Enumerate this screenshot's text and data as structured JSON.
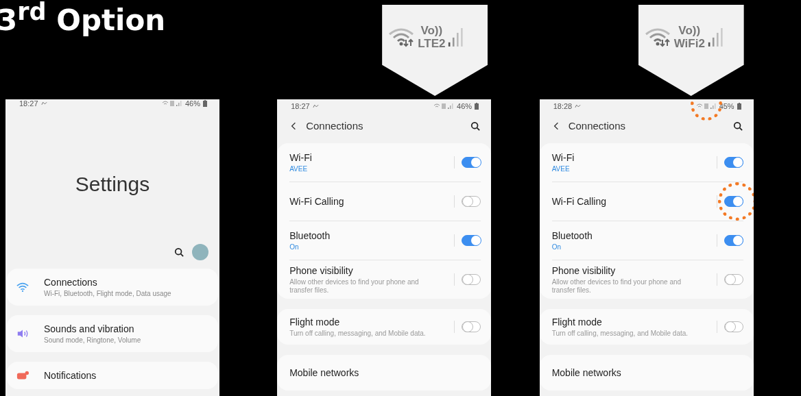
{
  "slide_title": "3$^{rd}$ Option",
  "phones": [
    {
      "kind": "home",
      "status": {
        "time": "18:27",
        "battery": "46%",
        "highlighted": false
      },
      "title": "Settings",
      "items": [
        {
          "kind": "wifi",
          "label": "Connections",
          "detail": "Wi-Fi, Bluetooth, Flight mode, Data usage"
        },
        {
          "kind": "sound",
          "label": "Sounds and vibration",
          "detail": "Sound mode, Ringtone, Volume"
        },
        {
          "kind": "notification",
          "label": "Notifications"
        }
      ]
    },
    {
      "kind": "connections",
      "callout": {
        "voice": "Vo))",
        "network": "LTE2"
      },
      "status": {
        "time": "18:27",
        "battery": "46%",
        "highlighted": false
      },
      "title": "Connections",
      "groups": [
        [
          {
            "kind": "toggle",
            "label": "Wi-Fi",
            "state_text": "AVEE",
            "on": true,
            "highlighted": false
          },
          {
            "kind": "toggle",
            "label": "Wi-Fi Calling",
            "on": false,
            "highlighted": false
          },
          {
            "kind": "toggle",
            "label": "Bluetooth",
            "state_text": "On",
            "on": true,
            "highlighted": false
          },
          {
            "kind": "toggle",
            "label": "Phone visibility",
            "description": "Allow other devices to find your phone and transfer files.",
            "on": false,
            "highlighted": false
          }
        ],
        [
          {
            "kind": "toggle",
            "label": "Flight mode",
            "description": "Turn off calling, messaging, and Mobile data.",
            "on": false,
            "highlighted": false
          }
        ],
        [
          {
            "kind": "link",
            "label": "Mobile networks"
          }
        ]
      ]
    },
    {
      "kind": "connections",
      "callout": {
        "voice": "Vo))",
        "network": "WiFi2"
      },
      "status": {
        "time": "18:28",
        "battery": "45%",
        "highlighted": true
      },
      "title": "Connections",
      "groups": [
        [
          {
            "kind": "toggle",
            "label": "Wi-Fi",
            "state_text": "AVEE",
            "on": true,
            "highlighted": false
          },
          {
            "kind": "toggle",
            "label": "Wi-Fi Calling",
            "on": true,
            "highlighted": true
          },
          {
            "kind": "toggle",
            "label": "Bluetooth",
            "state_text": "On",
            "on": true,
            "highlighted": false
          },
          {
            "kind": "toggle",
            "label": "Phone visibility",
            "description": "Allow other devices to find your phone and transfer files.",
            "on": false,
            "highlighted": false
          }
        ],
        [
          {
            "kind": "toggle",
            "label": "Flight mode",
            "description": "Turn off calling, messaging, and Mobile data.",
            "on": false,
            "highlighted": false
          }
        ],
        [
          {
            "kind": "link",
            "label": "Mobile networks"
          }
        ]
      ]
    }
  ]
}
